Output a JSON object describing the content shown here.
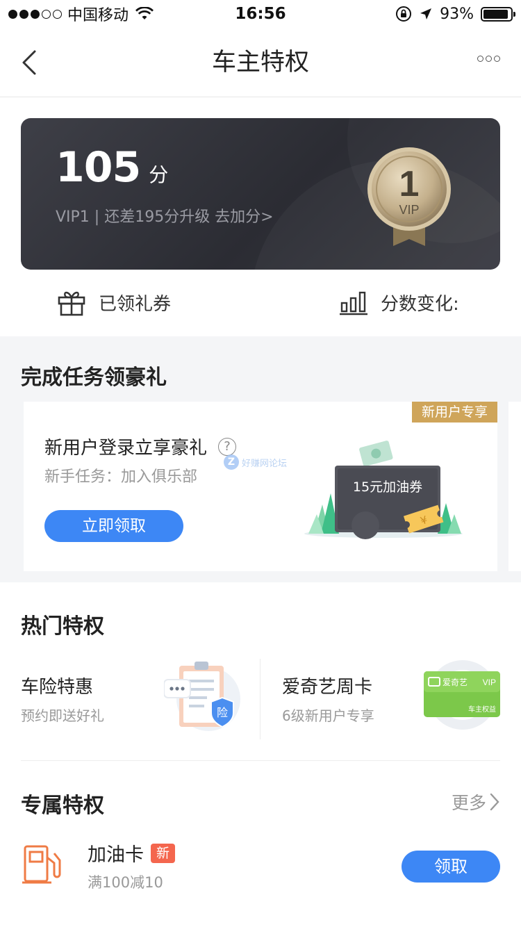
{
  "status_bar": {
    "carrier": "中国移动",
    "time": "16:56",
    "battery_text": "93%",
    "battery_level": 0.93
  },
  "nav": {
    "title": "车主特权"
  },
  "vip_card": {
    "score": "105",
    "score_unit": "分",
    "level_line": "VIP1 | 还差195分升级 去加分>",
    "medal_number": "1",
    "medal_label": "VIP"
  },
  "quick_links": [
    {
      "label": "已领礼券",
      "icon": "gift-icon"
    },
    {
      "label": "分数变化:",
      "icon": "bar-chart-icon"
    }
  ],
  "task_section": {
    "title": "完成任务领豪礼",
    "badge": "新用户专享",
    "heading": "新用户登录立享豪礼",
    "help_glyph": "?",
    "subtitle": "新手任务：加入俱乐部",
    "button": "立即领取",
    "coupon_text": "15元加油券",
    "coupon_symbol": "¥",
    "watermark_letter": "Z",
    "watermark_text": "好赚网论坛"
  },
  "hot_section": {
    "title": "热门特权",
    "items": [
      {
        "name": "车险特惠",
        "desc": "预约即送好礼",
        "icon": "insurance-icon",
        "icon_text": "险"
      },
      {
        "name": "爱奇艺周卡",
        "desc": "6级新用户专享",
        "icon": "iqiyi-card-icon",
        "card_brand": "爱奇艺",
        "card_vip": "VIP",
        "card_footer": "车主权益"
      }
    ]
  },
  "exclusive_section": {
    "title": "专属特权",
    "more": "更多",
    "items": [
      {
        "name": "加油卡",
        "tag": "新",
        "desc": "满100减10",
        "button": "领取",
        "icon": "fuel-pump-icon"
      }
    ]
  },
  "colors": {
    "accent_blue": "#3d87f5",
    "gold_badge": "#cfa55a",
    "new_tag_red": "#f4664e",
    "vip_card_dark": "#2b2c33"
  }
}
